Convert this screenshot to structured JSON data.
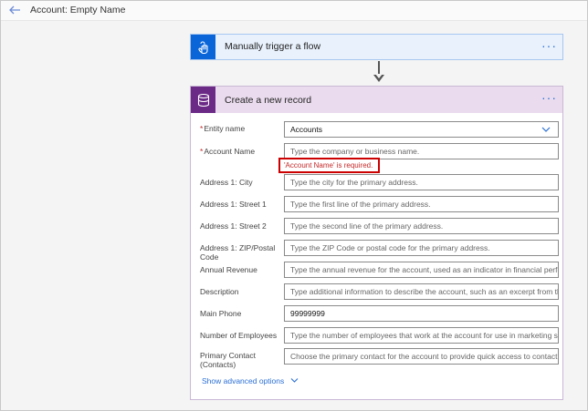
{
  "header": {
    "title": "Account: Empty Name"
  },
  "trigger": {
    "label": "Manually trigger a flow",
    "more": "···"
  },
  "action": {
    "label": "Create a new record",
    "more": "···",
    "fields": [
      {
        "key": "entity",
        "label": "Entity name",
        "required": "*",
        "value": "Accounts"
      },
      {
        "key": "account_name",
        "label": "Account Name",
        "required": "*",
        "placeholder": "Type the company or business name."
      },
      {
        "key": "city",
        "label": "Address 1: City",
        "placeholder": "Type the city for the primary address."
      },
      {
        "key": "street1",
        "label": "Address 1: Street 1",
        "placeholder": "Type the first line of the primary address."
      },
      {
        "key": "street2",
        "label": "Address 1: Street 2",
        "placeholder": "Type the second line of the primary address."
      },
      {
        "key": "zip",
        "label": "Address 1: ZIP/Postal Code",
        "placeholder": "Type the ZIP Code or postal code for the primary address."
      },
      {
        "key": "revenue",
        "label": "Annual Revenue",
        "placeholder": "Type the annual revenue for the account, used as an indicator in financial perfo"
      },
      {
        "key": "description",
        "label": "Description",
        "placeholder": "Type additional information to describe the account, such as an excerpt from th"
      },
      {
        "key": "phone",
        "label": "Main Phone",
        "value": "99999999"
      },
      {
        "key": "employees",
        "label": "Number of Employees",
        "placeholder": "Type the number of employees that work at the account for use in marketing se"
      },
      {
        "key": "contact",
        "label": "Primary Contact (Contacts)",
        "placeholder": "Choose the primary contact for the account to provide quick access to contact"
      }
    ],
    "error": "'Account Name' is required.",
    "advanced": "Show advanced options"
  },
  "icons": {
    "back": "back-arrow-icon",
    "trigger": "touch-hand-icon",
    "action": "database-icon",
    "dropdown": "chevron-down-icon"
  },
  "colors": {
    "trigger_accent": "#0a66d8",
    "action_accent": "#6b2a86",
    "error": "#cc0000",
    "link": "#2a6fd6"
  }
}
